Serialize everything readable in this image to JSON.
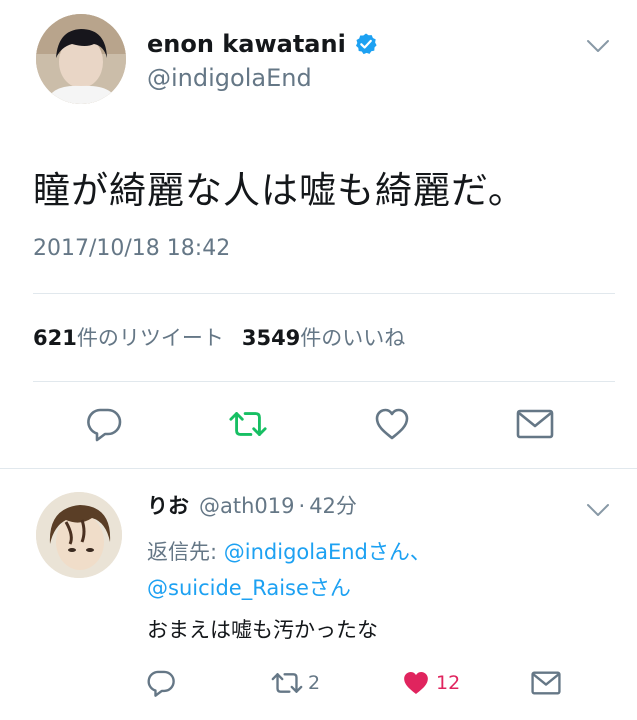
{
  "tweet": {
    "user": {
      "display_name": "enon kawatani",
      "handle": "@indigolaEnd",
      "verified": true
    },
    "text": "瞳が綺麗な人は嘘も綺麗だ。",
    "timestamp": "2017/10/18 18:42",
    "stats": {
      "retweet_count": "621",
      "retweet_label": "件のリツイート",
      "like_count": "3549",
      "like_label": "件のいいね"
    },
    "actions": {
      "reply_icon": "reply-icon",
      "retweet_icon": "retweet-icon",
      "like_icon": "heart-icon",
      "dm_icon": "envelope-icon",
      "retweet_color": "#17bf63"
    }
  },
  "reply": {
    "user": {
      "display_name": "りお",
      "handle": "@ath019",
      "time": "42分",
      "separator": "·"
    },
    "reply_to_label": "返信先:",
    "mentions": [
      "@indigolaEnd",
      "@suicide_Raise"
    ],
    "honorific": "さん",
    "comma": "、",
    "text": "おまえは嘘も汚かったな",
    "actions": {
      "retweet_count": "2",
      "like_count": "12",
      "like_color": "#e0245e",
      "liked": true
    }
  },
  "colors": {
    "text_primary": "#14171a",
    "text_secondary": "#657786",
    "link": "#1da1f2",
    "divider": "#e1e8ed",
    "verified": "#1da1f2"
  }
}
